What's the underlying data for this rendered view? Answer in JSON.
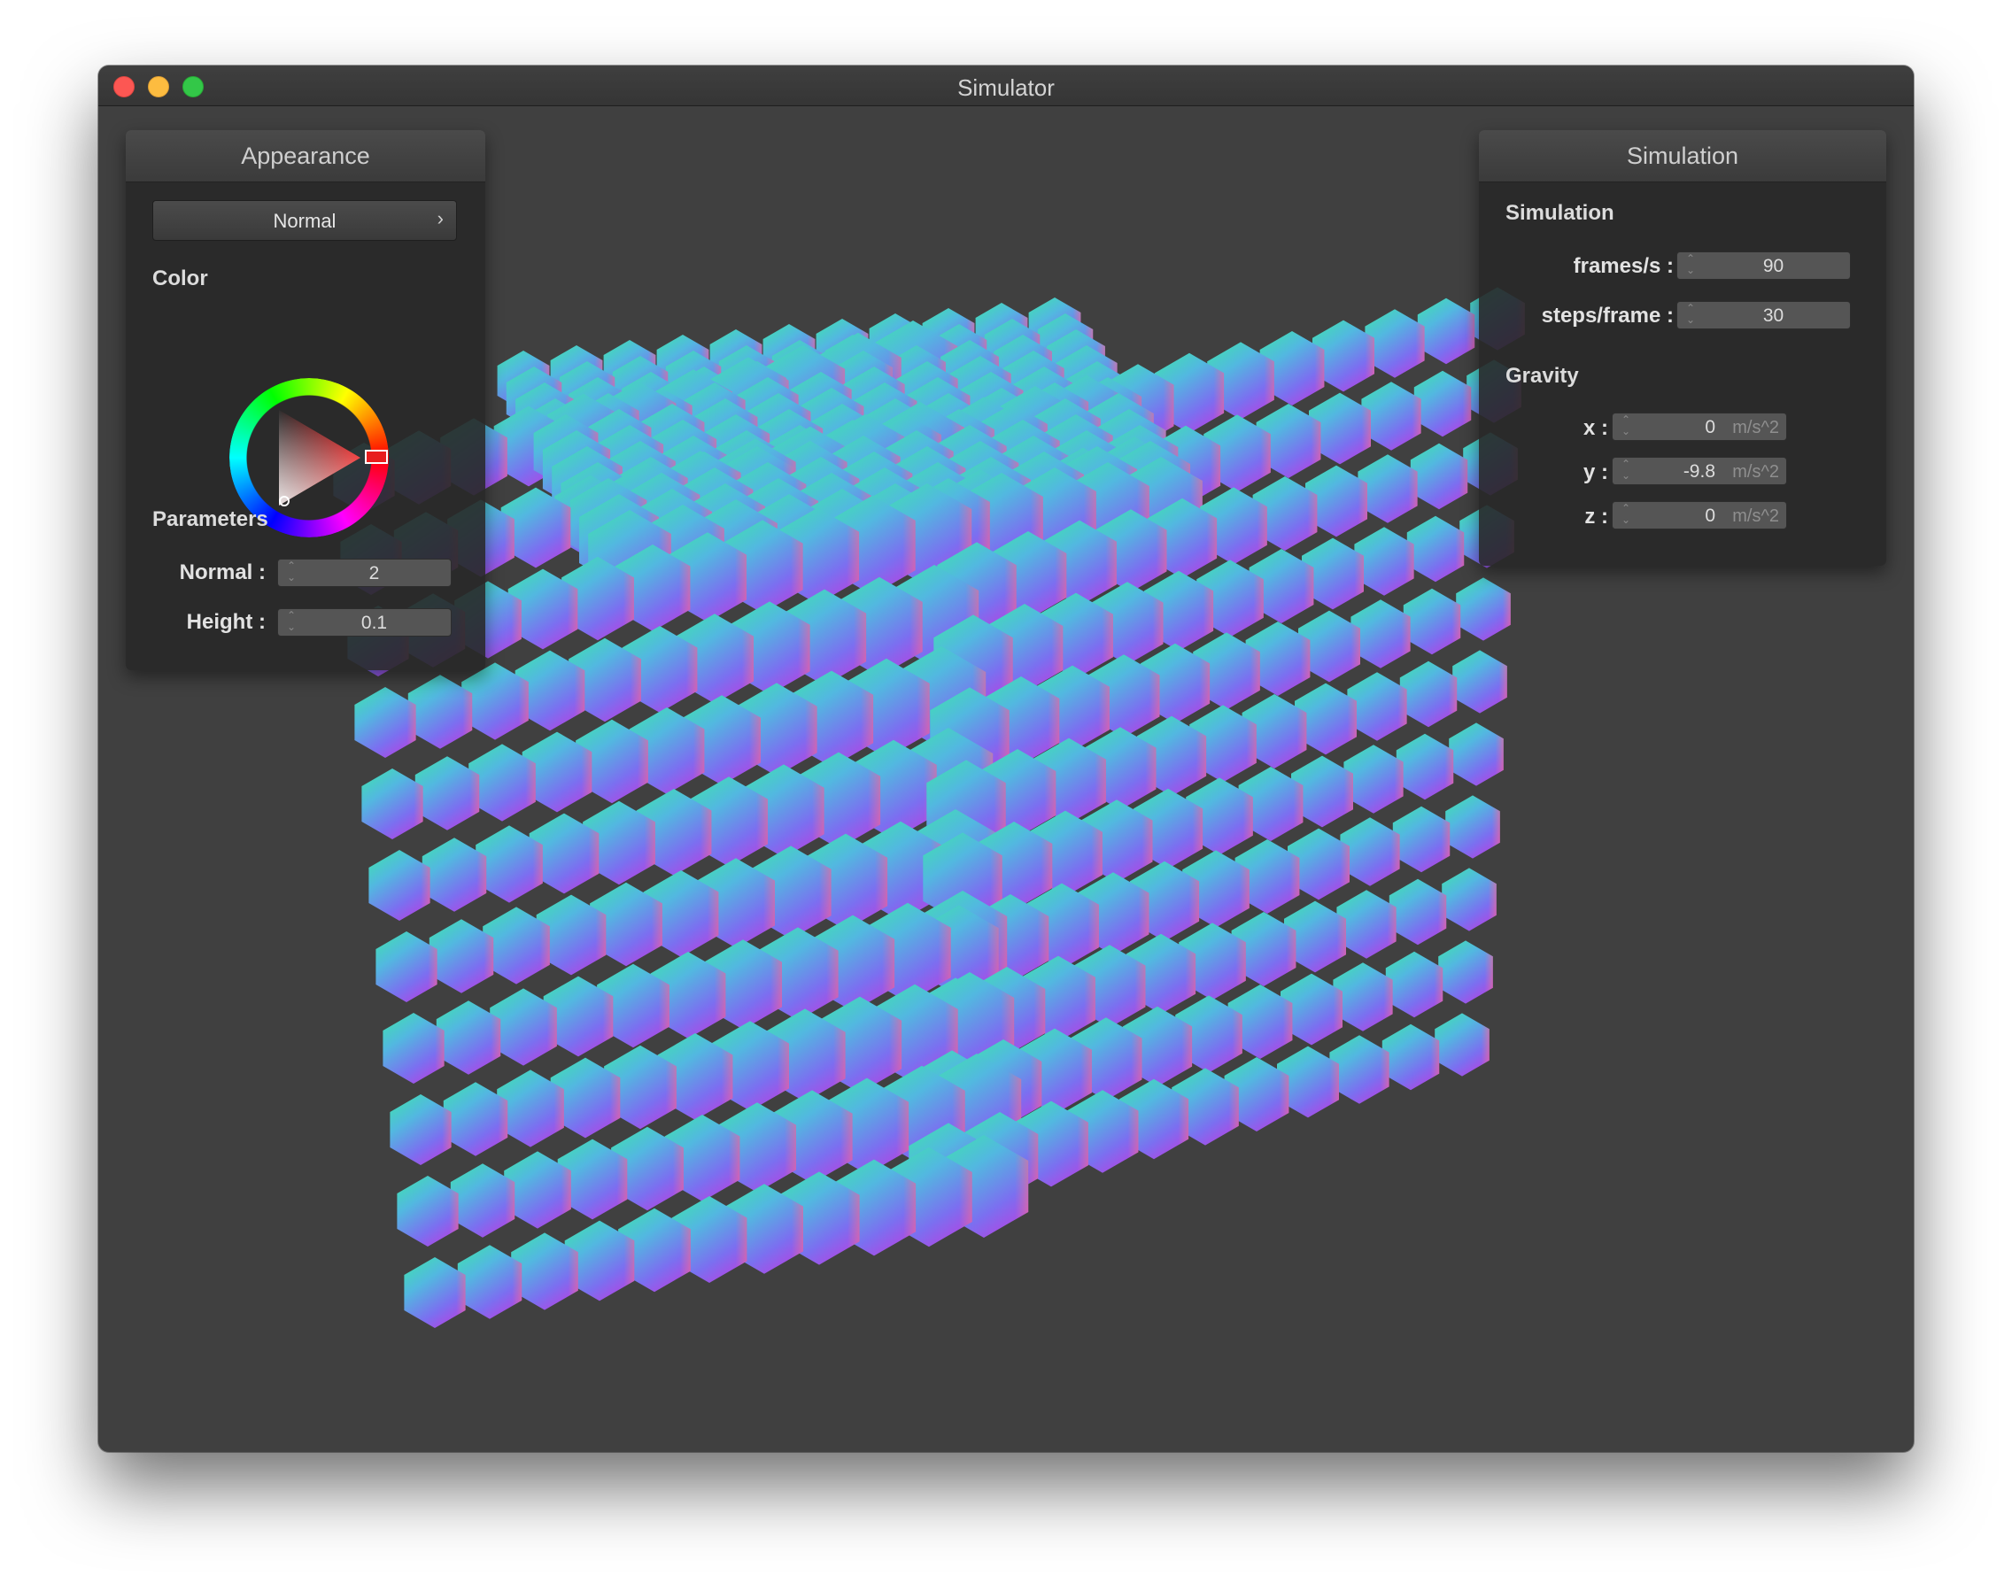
{
  "window": {
    "title": "Simulator"
  },
  "appearance": {
    "title": "Appearance",
    "mode": "Normal",
    "mode_icon": "chevron-right-icon",
    "color_label": "Color",
    "selected_color": "#e81d1d",
    "parameters_label": "Parameters",
    "normal_label": "Normal :",
    "normal_value": "2",
    "height_label": "Height :",
    "height_value": "0.1"
  },
  "simulation": {
    "title": "Simulation",
    "section_label": "Simulation",
    "fps_label": "frames/s :",
    "fps_value": "90",
    "steps_label": "steps/frame :",
    "steps_value": "30",
    "gravity_label": "Gravity",
    "gravity": [
      {
        "axis": "x :",
        "value": "0",
        "unit": "m/s^2"
      },
      {
        "axis": "y :",
        "value": "-9.8",
        "unit": "m/s^2"
      },
      {
        "axis": "z :",
        "value": "0",
        "unit": "m/s^2"
      }
    ]
  }
}
